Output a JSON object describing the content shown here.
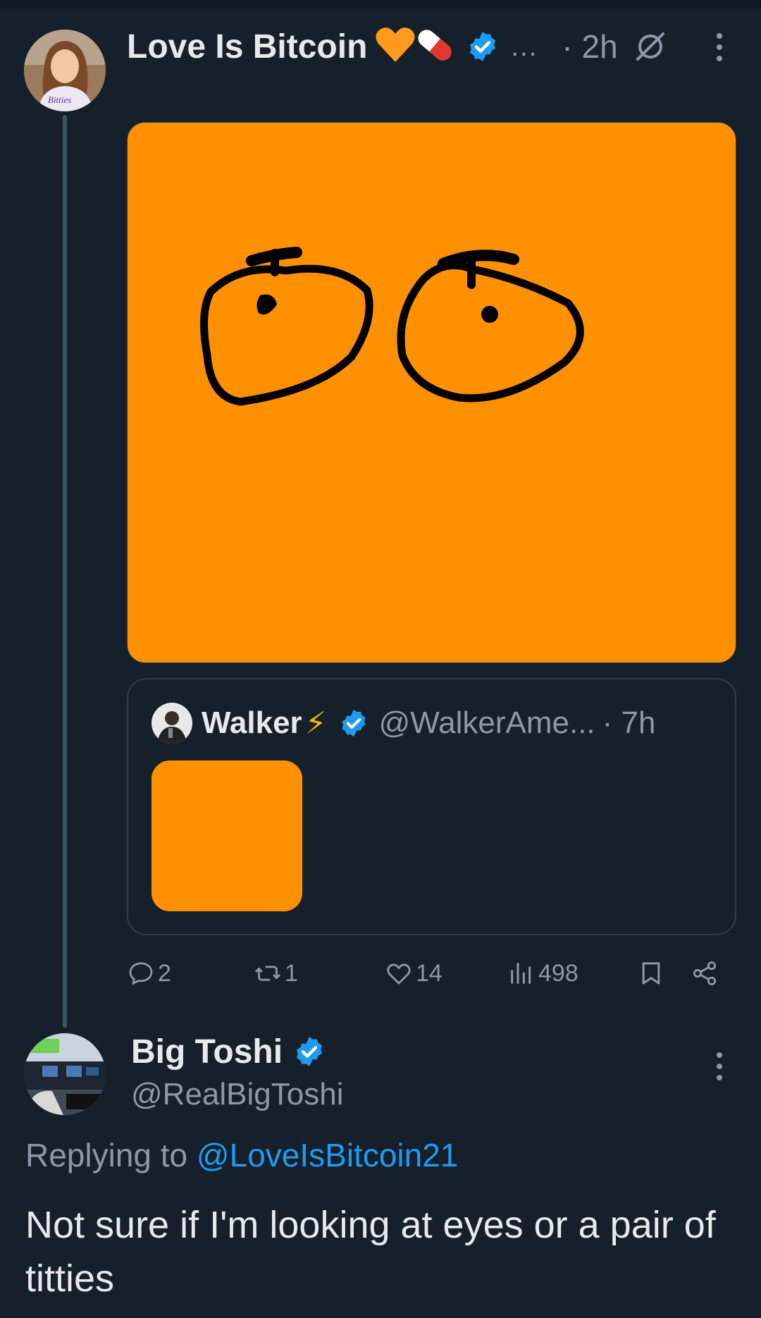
{
  "post": {
    "author_name": "Love Is Bitcoin",
    "author_emoji": "🧡💊",
    "ellipsis": "…",
    "time": "· 2h",
    "avatar_text": "Bitties",
    "media_image": "orange square with a hand-drawn pair of circles with dots",
    "quote": {
      "name": "Walker",
      "emoji": "⚡",
      "handle": "@WalkerAme...",
      "time": "· 7h"
    },
    "stats": {
      "replies": "2",
      "reposts": "1",
      "likes": "14",
      "views": "498"
    }
  },
  "reply": {
    "author_name": "Big Toshi",
    "handle": "@RealBigToshi",
    "replying_prefix": "Replying to ",
    "replying_to": "@LoveIsBitcoin21",
    "text": "Not sure if I'm looking at eyes or a pair of titties"
  },
  "colors": {
    "background": "#15202b",
    "accent": "#1d9bf0",
    "orange": "#ff9000",
    "muted": "#8b98a5"
  }
}
